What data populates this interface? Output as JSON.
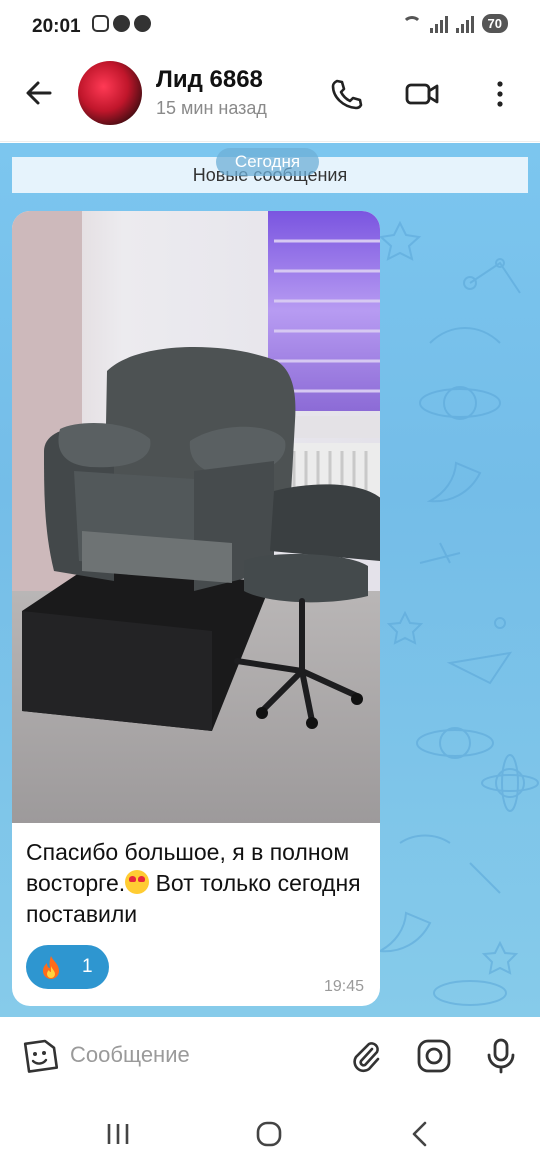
{
  "status": {
    "time": "20:01",
    "battery": "70"
  },
  "header": {
    "contact_name": "Лид 6868",
    "last_seen": "15 мин назад",
    "icons": [
      "back-arrow-icon",
      "phone-icon",
      "video-call-icon",
      "more-vertical-icon"
    ]
  },
  "chat": {
    "date_pill": "Сегодня",
    "new_messages_label": "Новые сообщения",
    "message": {
      "text_before_emoji": "Спасибо большое, я в полном восторге.",
      "text_after_emoji": " Вот только сегодня поставили",
      "emoji": "heart-eyes-emoji",
      "reaction_icon": "fire-emoji",
      "reaction_count": "1",
      "time": "19:45"
    }
  },
  "input": {
    "placeholder": "Сообщение",
    "icons": [
      "sticker-icon",
      "attach-icon",
      "camera-icon",
      "mic-icon"
    ]
  },
  "colors": {
    "chat_background": "#7cc6ef",
    "reaction": "#2e96d0"
  }
}
